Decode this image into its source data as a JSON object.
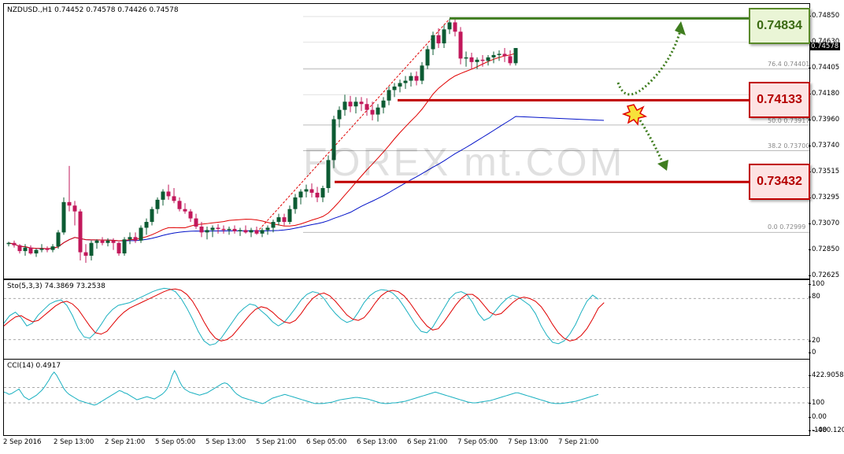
{
  "chart": {
    "symbol_info": "NZDUSD.,H1  0.74452 0.74578 0.74426 0.74578",
    "current_price_label": "0.74578",
    "watermark": "FOREX mt.COM",
    "price_axis": [
      "0.74850",
      "0.74630",
      "0.74405",
      "0.74180",
      "0.73960",
      "0.73740",
      "0.73515",
      "0.73295",
      "0.73070",
      "0.72850",
      "0.72625"
    ],
    "fib_labels": [
      "76.4  0.74401",
      "50.0  0.73917",
      "38.2  0.73700",
      "0.0  0.72999"
    ],
    "levels": {
      "top": "0.74834",
      "mid": "0.74133",
      "low": "0.73432"
    },
    "colors": {
      "bull": "#0c5b33",
      "bear": "#c2185b",
      "ma_fast": "#e00000",
      "ma_slow": "#0010c8",
      "level_green": "#3f7d1f",
      "level_red": "#c00000",
      "stoch_main": "#19b0c0",
      "stoch_signal": "#e00000",
      "cci": "#19b0c0"
    },
    "candles": [
      [
        0.729,
        0.7292,
        0.7288,
        0.7291
      ],
      [
        0.7291,
        0.7293,
        0.7287,
        0.7289
      ],
      [
        0.7289,
        0.729,
        0.7282,
        0.7284
      ],
      [
        0.7284,
        0.729,
        0.728,
        0.7287
      ],
      [
        0.7287,
        0.7289,
        0.7281,
        0.7282
      ],
      [
        0.7282,
        0.7286,
        0.7279,
        0.7285
      ],
      [
        0.7285,
        0.729,
        0.7283,
        0.7286
      ],
      [
        0.7286,
        0.7288,
        0.7283,
        0.7285
      ],
      [
        0.7285,
        0.729,
        0.7283,
        0.7288
      ],
      [
        0.7288,
        0.7302,
        0.7286,
        0.73
      ],
      [
        0.73,
        0.733,
        0.7298,
        0.7326
      ],
      [
        0.7326,
        0.7357,
        0.7318,
        0.7323
      ],
      [
        0.7323,
        0.7327,
        0.7306,
        0.7318
      ],
      [
        0.7318,
        0.732,
        0.7276,
        0.7283
      ],
      [
        0.7283,
        0.729,
        0.7274,
        0.728
      ],
      [
        0.728,
        0.7293,
        0.7276,
        0.7291
      ],
      [
        0.7291,
        0.7294,
        0.7286,
        0.7293
      ],
      [
        0.7293,
        0.7296,
        0.7289,
        0.7291
      ],
      [
        0.7291,
        0.7295,
        0.7288,
        0.7293
      ],
      [
        0.7293,
        0.7295,
        0.7285,
        0.7291
      ],
      [
        0.7291,
        0.7292,
        0.728,
        0.7282
      ],
      [
        0.7282,
        0.7296,
        0.728,
        0.7294
      ],
      [
        0.7294,
        0.73,
        0.729,
        0.7296
      ],
      [
        0.7296,
        0.73,
        0.7291,
        0.7293
      ],
      [
        0.7293,
        0.7306,
        0.7291,
        0.7304
      ],
      [
        0.7304,
        0.7312,
        0.7298,
        0.7309
      ],
      [
        0.7309,
        0.7322,
        0.7306,
        0.732
      ],
      [
        0.732,
        0.733,
        0.7316,
        0.7328
      ],
      [
        0.7328,
        0.7337,
        0.7323,
        0.7335
      ],
      [
        0.7335,
        0.7341,
        0.7328,
        0.7331
      ],
      [
        0.7331,
        0.7338,
        0.7325,
        0.7327
      ],
      [
        0.7327,
        0.733,
        0.7318,
        0.732
      ],
      [
        0.732,
        0.7325,
        0.7316,
        0.7318
      ],
      [
        0.7318,
        0.732,
        0.7309,
        0.7312
      ],
      [
        0.7312,
        0.7316,
        0.7303,
        0.7305
      ],
      [
        0.7305,
        0.7309,
        0.7296,
        0.73
      ],
      [
        0.73,
        0.7305,
        0.7294,
        0.7302
      ],
      [
        0.7302,
        0.7306,
        0.7296,
        0.7304
      ],
      [
        0.7304,
        0.7307,
        0.7299,
        0.7303
      ],
      [
        0.7303,
        0.7306,
        0.7299,
        0.7302
      ],
      [
        0.7302,
        0.7305,
        0.7298,
        0.7303
      ],
      [
        0.7303,
        0.7306,
        0.7299,
        0.7301
      ],
      [
        0.7301,
        0.7304,
        0.7297,
        0.7302
      ],
      [
        0.7302,
        0.7306,
        0.7299,
        0.73
      ],
      [
        0.73,
        0.7304,
        0.7296,
        0.7302
      ],
      [
        0.7302,
        0.7305,
        0.7298,
        0.7299
      ],
      [
        0.7299,
        0.7304,
        0.7296,
        0.7302
      ],
      [
        0.7302,
        0.7306,
        0.7298,
        0.7304
      ],
      [
        0.7304,
        0.7311,
        0.73,
        0.7309
      ],
      [
        0.7309,
        0.7316,
        0.7306,
        0.7313
      ],
      [
        0.7313,
        0.7316,
        0.7306,
        0.7309
      ],
      [
        0.7309,
        0.7323,
        0.7307,
        0.732
      ],
      [
        0.732,
        0.7333,
        0.7316,
        0.733
      ],
      [
        0.733,
        0.7337,
        0.7324,
        0.7335
      ],
      [
        0.7335,
        0.7341,
        0.733,
        0.7337
      ],
      [
        0.7337,
        0.7342,
        0.733,
        0.7334
      ],
      [
        0.7334,
        0.7339,
        0.7326,
        0.733
      ],
      [
        0.733,
        0.734,
        0.7326,
        0.7338
      ],
      [
        0.7338,
        0.7366,
        0.7334,
        0.7362
      ],
      [
        0.7362,
        0.74,
        0.7355,
        0.7397
      ],
      [
        0.7397,
        0.7408,
        0.739,
        0.7405
      ],
      [
        0.7405,
        0.7418,
        0.74,
        0.7412
      ],
      [
        0.7412,
        0.7417,
        0.7403,
        0.7408
      ],
      [
        0.7408,
        0.7416,
        0.7402,
        0.7412
      ],
      [
        0.7412,
        0.7416,
        0.7404,
        0.741
      ],
      [
        0.741,
        0.7415,
        0.74,
        0.7405
      ],
      [
        0.7405,
        0.7412,
        0.7396,
        0.7401
      ],
      [
        0.7401,
        0.741,
        0.7395,
        0.7407
      ],
      [
        0.7407,
        0.7416,
        0.7402,
        0.7413
      ],
      [
        0.7413,
        0.7425,
        0.7409,
        0.7422
      ],
      [
        0.7422,
        0.7428,
        0.7416,
        0.7425
      ],
      [
        0.7425,
        0.7431,
        0.742,
        0.7428
      ],
      [
        0.7428,
        0.7434,
        0.7423,
        0.743
      ],
      [
        0.743,
        0.7437,
        0.7425,
        0.7434
      ],
      [
        0.7434,
        0.7438,
        0.7426,
        0.743
      ],
      [
        0.743,
        0.7446,
        0.7427,
        0.7443
      ],
      [
        0.7443,
        0.746,
        0.744,
        0.7457
      ],
      [
        0.7457,
        0.7472,
        0.7452,
        0.7469
      ],
      [
        0.7469,
        0.7475,
        0.7458,
        0.7462
      ],
      [
        0.7462,
        0.7478,
        0.7458,
        0.7474
      ],
      [
        0.7474,
        0.7483,
        0.747,
        0.748
      ],
      [
        0.748,
        0.7484,
        0.7468,
        0.7472
      ],
      [
        0.7472,
        0.7476,
        0.7444,
        0.7449
      ],
      [
        0.7449,
        0.7455,
        0.7442,
        0.745
      ],
      [
        0.745,
        0.7454,
        0.744,
        0.7446
      ],
      [
        0.7446,
        0.745,
        0.744,
        0.7448
      ],
      [
        0.7448,
        0.7452,
        0.7442,
        0.7447
      ],
      [
        0.7447,
        0.7452,
        0.7443,
        0.745
      ],
      [
        0.745,
        0.7455,
        0.7445,
        0.7452
      ],
      [
        0.7452,
        0.7456,
        0.7447,
        0.7453
      ],
      [
        0.7453,
        0.7458,
        0.7446,
        0.7451
      ],
      [
        0.7451,
        0.7456,
        0.7443,
        0.7445
      ],
      [
        0.7445,
        0.7458,
        0.7443,
        0.7458
      ]
    ],
    "stoch_axis": [
      "100",
      "80",
      "20",
      "0"
    ],
    "stoch_label": "Sto(5,3,3) 74.3869 73.2538",
    "stoch_main": [
      44,
      55,
      60,
      52,
      40,
      44,
      56,
      64,
      72,
      76,
      78,
      70,
      55,
      36,
      24,
      22,
      30,
      42,
      55,
      64,
      70,
      72,
      74,
      78,
      82,
      86,
      90,
      93,
      95,
      94,
      90,
      80,
      66,
      50,
      32,
      18,
      12,
      14,
      22,
      34,
      46,
      58,
      66,
      72,
      70,
      62,
      55,
      46,
      40,
      45,
      55,
      66,
      78,
      86,
      90,
      88,
      80,
      68,
      58,
      50,
      45,
      48,
      60,
      74,
      84,
      90,
      93,
      92,
      88,
      80,
      68,
      55,
      42,
      32,
      30,
      38,
      52,
      66,
      80,
      88,
      90,
      86,
      74,
      58,
      48,
      52,
      62,
      72,
      80,
      85,
      82,
      76,
      70,
      58,
      40,
      26,
      16,
      14,
      18,
      28,
      42,
      60,
      76,
      85,
      79
    ],
    "stoch_signal": [
      40,
      47,
      53,
      55,
      50,
      46,
      48,
      55,
      62,
      69,
      74,
      76,
      72,
      64,
      52,
      40,
      30,
      28,
      32,
      42,
      52,
      60,
      66,
      70,
      74,
      78,
      82,
      86,
      90,
      93,
      94,
      92,
      86,
      76,
      62,
      46,
      32,
      22,
      18,
      20,
      26,
      36,
      46,
      56,
      64,
      68,
      66,
      60,
      52,
      46,
      44,
      48,
      58,
      70,
      80,
      86,
      88,
      84,
      76,
      66,
      56,
      50,
      48,
      52,
      62,
      74,
      84,
      90,
      92,
      90,
      84,
      74,
      62,
      50,
      40,
      34,
      36,
      46,
      58,
      70,
      80,
      86,
      86,
      80,
      70,
      60,
      56,
      58,
      66,
      74,
      80,
      82,
      80,
      76,
      68,
      56,
      42,
      30,
      22,
      18,
      20,
      26,
      36,
      50,
      66,
      74
    ]
  },
  "cci": {
    "label": "CCI(14) 0.4917",
    "axis": [
      "422.9058",
      "100",
      "0.00",
      "-100",
      "-480.1203"
    ],
    "values": [
      40,
      30,
      10,
      20,
      40,
      60,
      80,
      30,
      -20,
      -40,
      -60,
      -40,
      -20,
      0,
      30,
      60,
      100,
      150,
      200,
      260,
      300,
      260,
      200,
      140,
      80,
      40,
      10,
      -10,
      -30,
      -50,
      -70,
      -80,
      -90,
      -100,
      -110,
      -120,
      -130,
      -120,
      -100,
      -80,
      -60,
      -40,
      -20,
      0,
      20,
      40,
      60,
      50,
      30,
      20,
      0,
      -20,
      -40,
      -60,
      -50,
      -40,
      -30,
      -20,
      -30,
      -40,
      -50,
      -30,
      -10,
      10,
      40,
      80,
      150,
      250,
      320,
      260,
      180,
      120,
      80,
      60,
      40,
      30,
      20,
      10,
      0,
      10,
      20,
      30,
      50,
      70,
      90,
      110,
      130,
      150,
      160,
      150,
      120,
      80,
      40,
      10,
      -10,
      -30,
      -40,
      -50,
      -60,
      -70,
      -80,
      -90,
      -100,
      -110,
      -100,
      -80,
      -60,
      -40,
      -30,
      -20,
      -10,
      0,
      10,
      0,
      -10,
      -20,
      -30,
      -40,
      -50,
      -60,
      -70,
      -80,
      -90,
      -100,
      -110,
      -110,
      -110,
      -110,
      -105,
      -100,
      -95,
      -90,
      -80,
      -70,
      -60,
      -55,
      -50,
      -45,
      -40,
      -35,
      -30,
      -30,
      -35,
      -40,
      -45,
      -50,
      -60,
      -70,
      -80,
      -90,
      -100,
      -105,
      -110,
      -110,
      -105,
      -100,
      -100,
      -95,
      -90,
      -85,
      -80,
      -70,
      -60,
      -50,
      -40,
      -30,
      -20,
      -10,
      0,
      10,
      20,
      30,
      40,
      30,
      20,
      10,
      0,
      -10,
      -20,
      -30,
      -40,
      -50,
      -60,
      -70,
      -80,
      -90,
      -95,
      -100,
      -100,
      -95,
      -90,
      -85,
      -80,
      -75,
      -70,
      -60,
      -50,
      -40,
      -30,
      -20,
      -10,
      0,
      10,
      20,
      30,
      30,
      20,
      10,
      0,
      -10,
      -20,
      -30,
      -40,
      -50,
      -60,
      -70,
      -80,
      -90,
      -100,
      -105,
      -110,
      -110,
      -110,
      -105,
      -100,
      -95,
      -90,
      -85,
      -80,
      -70,
      -60,
      -50,
      -40,
      -30,
      -20,
      -10,
      0,
      10
    ]
  },
  "time_axis": [
    "2 Sep 2016",
    "2 Sep 13:00",
    "2 Sep 21:00",
    "5 Sep 05:00",
    "5 Sep 13:00",
    "5 Sep 21:00",
    "6 Sep 05:00",
    "6 Sep 13:00",
    "6 Sep 21:00",
    "7 Sep 05:00",
    "7 Sep 13:00",
    "7 Sep 21:00"
  ]
}
